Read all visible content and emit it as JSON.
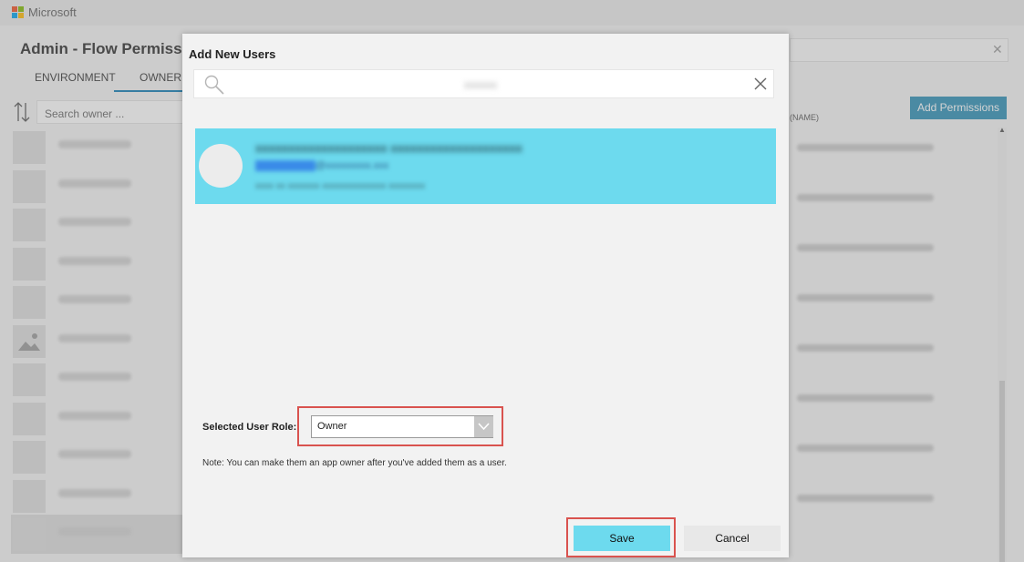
{
  "app": {
    "brand": "Microsoft",
    "title": "Admin - Flow Permissio",
    "tabs": [
      {
        "label": "ENVIRONMENT"
      },
      {
        "label": "OWNER"
      }
    ],
    "search_owner_placeholder": "Search owner ...",
    "add_permissions_label": "Add Permissions",
    "column_header": "(NAME)",
    "colors": {
      "accent": "#2d8fb6",
      "tab_underline": "#0f7bb4",
      "logo_red": "#f25022",
      "logo_green": "#7fba00",
      "logo_blue": "#00a4ef",
      "logo_yellow": "#ffb900"
    }
  },
  "dialog": {
    "title": "Add New Users",
    "search_query": "xxxxxx",
    "result": {
      "name": "xxxxxxxxxxxxxxxxxxxx xxxxxxxxxxxxxxxxxxxx",
      "email_highlight": "xxxxxxxxxxxx",
      "email_rest": "@xxxxxxxxx.xxx",
      "user_id": "xxxx xx xxxxxxx xxxxxxxxxxxxxx xxxxxxxx",
      "highlight_color": "#6ddaee"
    },
    "role_label": "Selected User Role:",
    "role_value": "Owner",
    "note": "Note: You can make them an app owner after you've added them as a user.",
    "save_label": "Save",
    "cancel_label": "Cancel",
    "annotation_color": "#d9534f"
  }
}
